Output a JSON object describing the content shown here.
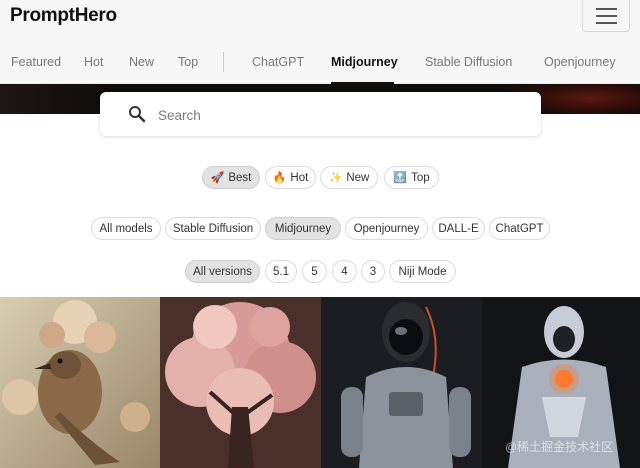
{
  "app": {
    "logo": "PromptHero"
  },
  "header": {
    "menu_icon": "hamburger-menu-icon"
  },
  "nav": {
    "items": [
      {
        "label": "Featured",
        "active": false
      },
      {
        "label": "Hot",
        "active": false
      },
      {
        "label": "New",
        "active": false
      },
      {
        "label": "Top",
        "active": false
      },
      {
        "label": "ChatGPT",
        "active": false
      },
      {
        "label": "Midjourney",
        "active": true
      },
      {
        "label": "Stable Diffusion",
        "active": false
      },
      {
        "label": "Openjourney",
        "active": false
      }
    ]
  },
  "search": {
    "placeholder": "Search",
    "value": "",
    "icon": "magnifier-icon"
  },
  "sort_tabs": [
    {
      "label": "Best",
      "emoji": "🚀",
      "selected": true
    },
    {
      "label": "Hot",
      "emoji": "🔥",
      "selected": false
    },
    {
      "label": "New",
      "emoji": "✨",
      "selected": false
    },
    {
      "label": "Top",
      "emoji": "🔝",
      "selected": false
    }
  ],
  "model_filters": [
    {
      "label": "All models",
      "selected": false
    },
    {
      "label": "Stable Diffusion",
      "selected": false
    },
    {
      "label": "Midjourney",
      "selected": true
    },
    {
      "label": "Openjourney",
      "selected": false
    },
    {
      "label": "DALL-E",
      "selected": false
    },
    {
      "label": "ChatGPT",
      "selected": false
    }
  ],
  "version_filters": [
    {
      "label": "All versions",
      "selected": true
    },
    {
      "label": "5.1",
      "selected": false
    },
    {
      "label": "5",
      "selected": false
    },
    {
      "label": "4",
      "selected": false
    },
    {
      "label": "3",
      "selected": false
    },
    {
      "label": "Niji Mode",
      "selected": false
    }
  ],
  "watermark": "@稀土掘金技术社区",
  "colors": {
    "accent": "#111111",
    "nav_bg": "#f7f7f7",
    "pill_selected": "#e2e2e2"
  }
}
